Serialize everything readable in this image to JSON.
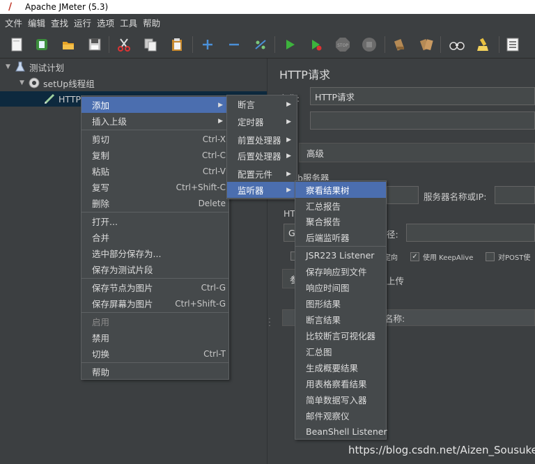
{
  "window": {
    "title": "Apache JMeter (5.3)"
  },
  "menubar": [
    "文件",
    "编辑",
    "查找",
    "运行",
    "选项",
    "工具",
    "帮助"
  ],
  "toolbar": {
    "icons": [
      "new-icon",
      "templates-icon",
      "open-icon",
      "save-icon",
      "cut-icon",
      "copy-icon",
      "paste-icon",
      "expand-icon",
      "collapse-icon",
      "toggle-icon",
      "start-icon",
      "start-no-pause-icon",
      "stop-icon",
      "shutdown-icon",
      "clear-icon",
      "clear-all-icon",
      "search-icon",
      "reset-search-icon",
      "function-helper-icon"
    ]
  },
  "tree": {
    "items": [
      {
        "label": "测试计划",
        "icon": "test-plan-icon"
      },
      {
        "label": "setUp线程组",
        "icon": "gear-icon"
      },
      {
        "label": "HTTP",
        "icon": "sampler-pencil-icon"
      }
    ]
  },
  "right_panel": {
    "title": "HTTP请求",
    "name_label": "名称:",
    "name_value": "HTTP请求",
    "comment_label": ":",
    "advanced_tab": "高级",
    "web_server_label": "b服务器",
    "server_name_label": "服务器名称或IP:",
    "http_label": "HT",
    "method_value": "G",
    "path_label": "径:",
    "redirect_label": "定向",
    "keepalive_label": "使用 KeepAlive",
    "multipart_label": "对POST使",
    "param_tab": "参",
    "upload_tab": "上传",
    "param_name_header": "名称:"
  },
  "context_menu": {
    "items": [
      {
        "label": "添加",
        "submenu": true,
        "highlight": true
      },
      {
        "label": "插入上级",
        "submenu": true
      },
      {
        "label": "剪切",
        "shortcut": "Ctrl-X"
      },
      {
        "label": "复制",
        "shortcut": "Ctrl-C"
      },
      {
        "label": "粘贴",
        "shortcut": "Ctrl-V"
      },
      {
        "label": "复写",
        "shortcut": "Ctrl+Shift-C"
      },
      {
        "label": "删除",
        "shortcut": "Delete"
      },
      {
        "label": "打开..."
      },
      {
        "label": "合并"
      },
      {
        "label": "选中部分保存为..."
      },
      {
        "label": "保存为测试片段"
      },
      {
        "label": "保存节点为图片",
        "shortcut": "Ctrl-G"
      },
      {
        "label": "保存屏幕为图片",
        "shortcut": "Ctrl+Shift-G"
      },
      {
        "label": "启用",
        "disabled": true
      },
      {
        "label": "禁用"
      },
      {
        "label": "切换",
        "shortcut": "Ctrl-T"
      },
      {
        "label": "帮助"
      }
    ]
  },
  "add_submenu": {
    "items": [
      {
        "label": "断言"
      },
      {
        "label": "定时器"
      },
      {
        "label": "前置处理器"
      },
      {
        "label": "后置处理器"
      },
      {
        "label": "配置元件"
      },
      {
        "label": "监听器",
        "highlight": true
      }
    ]
  },
  "listener_submenu": {
    "items": [
      {
        "label": "察看结果树",
        "highlight": true
      },
      {
        "label": "汇总报告"
      },
      {
        "label": "聚合报告"
      },
      {
        "label": "后端监听器"
      },
      {
        "label": "JSR223 Listener"
      },
      {
        "label": "保存响应到文件"
      },
      {
        "label": "响应时间图"
      },
      {
        "label": "图形结果"
      },
      {
        "label": "断言结果"
      },
      {
        "label": "比较断言可视化器"
      },
      {
        "label": "汇总图"
      },
      {
        "label": "生成概要结果"
      },
      {
        "label": "用表格察看结果"
      },
      {
        "label": "简单数据写入器"
      },
      {
        "label": "邮件观察仪"
      },
      {
        "label": "BeanShell Listener"
      }
    ]
  },
  "watermark": "https://blog.csdn.net/Aizen_Sousuke",
  "colors": {
    "highlight": "#4b6eaf",
    "background": "#3c3f41",
    "menu_bg": "#45494b"
  }
}
